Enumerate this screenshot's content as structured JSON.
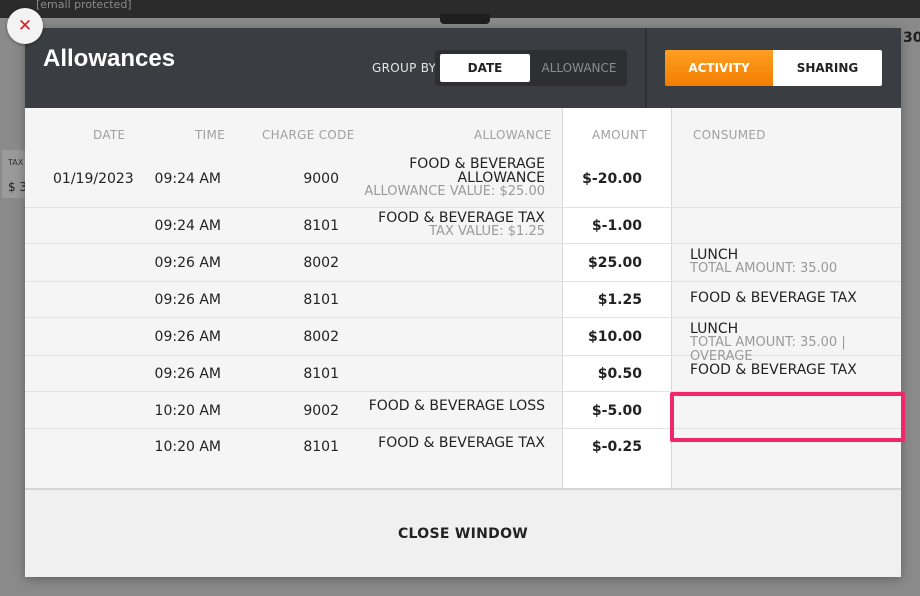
{
  "background": {
    "topbar_text": "[email protected]",
    "header_number": "30",
    "card_label": "TAX",
    "card_value": "$ 3"
  },
  "modal": {
    "title": "Allowances",
    "group_by": {
      "label": "GROUP BY",
      "options": [
        "DATE",
        "ALLOWANCE"
      ],
      "selected": "DATE"
    },
    "view_tabs": {
      "activity": "ACTIVITY",
      "sharing": "SHARING",
      "selected": "ACTIVITY"
    },
    "columns": [
      "DATE",
      "TIME",
      "CHARGE CODE",
      "ALLOWANCE",
      "AMOUNT",
      "CONSUMED"
    ],
    "rows": [
      {
        "date": "01/19/2023",
        "time": "09:24 AM",
        "code": "9000",
        "allowance": "FOOD & BEVERAGE",
        "allowance2": "ALLOWANCE",
        "allowance_sub": "ALLOWANCE VALUE: $25.00",
        "amount": "$-20.00",
        "consumed": "",
        "consumed_sub": ""
      },
      {
        "date": "",
        "time": "09:24 AM",
        "code": "8101",
        "allowance": "FOOD & BEVERAGE TAX",
        "allowance2": "",
        "allowance_sub": "TAX VALUE: $1.25",
        "amount": "$-1.00",
        "consumed": "",
        "consumed_sub": ""
      },
      {
        "date": "",
        "time": "09:26 AM",
        "code": "8002",
        "allowance": "",
        "allowance2": "",
        "allowance_sub": "",
        "amount": "$25.00",
        "consumed": "LUNCH",
        "consumed_sub": "TOTAL AMOUNT: 35.00"
      },
      {
        "date": "",
        "time": "09:26 AM",
        "code": "8101",
        "allowance": "",
        "allowance2": "",
        "allowance_sub": "",
        "amount": "$1.25",
        "consumed": "FOOD & BEVERAGE TAX",
        "consumed_sub": ""
      },
      {
        "date": "",
        "time": "09:26 AM",
        "code": "8002",
        "allowance": "",
        "allowance2": "",
        "allowance_sub": "",
        "amount": "$10.00",
        "consumed": "LUNCH",
        "consumed_sub": "TOTAL AMOUNT: 35.00 | OVERAGE"
      },
      {
        "date": "",
        "time": "09:26 AM",
        "code": "8101",
        "allowance": "",
        "allowance2": "",
        "allowance_sub": "",
        "amount": "$0.50",
        "consumed": "FOOD & BEVERAGE TAX",
        "consumed_sub": ""
      },
      {
        "date": "",
        "time": "10:20 AM",
        "code": "9002",
        "allowance": "FOOD & BEVERAGE LOSS",
        "allowance2": "",
        "allowance_sub": "",
        "amount": "$-5.00",
        "consumed": "",
        "consumed_sub": ""
      },
      {
        "date": "",
        "time": "10:20 AM",
        "code": "8101",
        "allowance": "FOOD & BEVERAGE TAX",
        "allowance2": "",
        "allowance_sub": "",
        "amount": "$-0.25",
        "consumed": "",
        "consumed_sub": ""
      }
    ],
    "close_label": "CLOSE WINDOW"
  },
  "colors": {
    "header": "#3a3d41",
    "accent_orange": "#f58b10",
    "highlight": "#f0286a"
  }
}
